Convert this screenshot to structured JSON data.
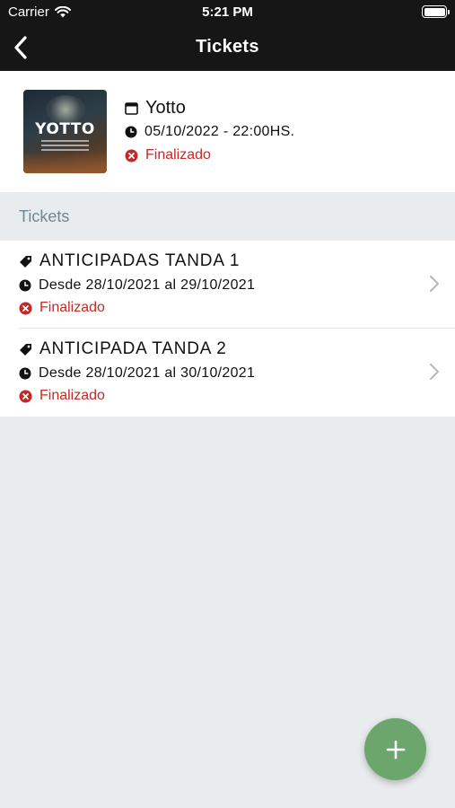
{
  "status_bar": {
    "carrier": "Carrier",
    "time": "5:21 PM",
    "icons": [
      "wifi-icon",
      "battery-icon"
    ]
  },
  "nav": {
    "title": "Tickets",
    "back_icon": "chevron-left-icon"
  },
  "event": {
    "poster_text": "YOTTO",
    "name": "Yotto",
    "datetime": "05/10/2022 - 22:00HS.",
    "status": "Finalizado",
    "icons": [
      "calendar-icon",
      "clock-icon",
      "close-circle-icon"
    ]
  },
  "section": {
    "title": "Tickets"
  },
  "tickets": [
    {
      "name": "ANTICIPADAS TANDA 1",
      "range": "Desde 28/10/2021 al 29/10/2021",
      "status": "Finalizado"
    },
    {
      "name": "ANTICIPADA TANDA 2",
      "range": "Desde 28/10/2021 al 30/10/2021",
      "status": "Finalizado"
    }
  ],
  "fab": {
    "icon": "plus-icon"
  },
  "colors": {
    "header_bg": "#161616",
    "status_error": "#c62828",
    "fab": "#6da66d",
    "section_text": "#6f8694",
    "background": "#e9ecee"
  }
}
